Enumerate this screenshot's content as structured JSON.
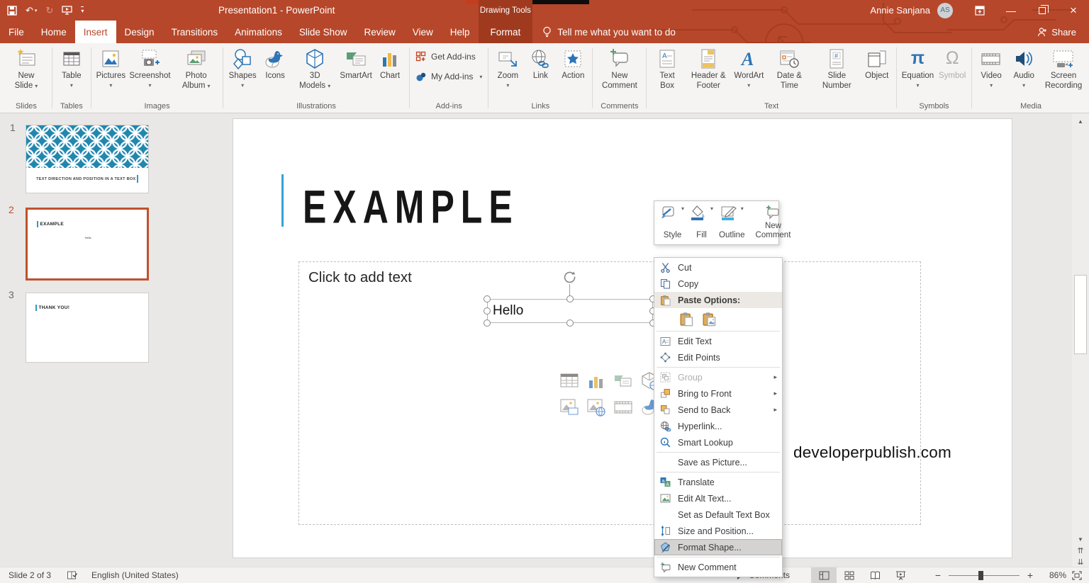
{
  "window": {
    "title": "Presentation1 - PowerPoint",
    "contextual_label": "Drawing Tools",
    "user_name": "Annie Sanjana",
    "user_initials": "AS"
  },
  "icons": {
    "dropdown": "▾",
    "submenu": "▸",
    "undo": "↶",
    "redo": "↻",
    "scroll_up": "▲",
    "scroll_down": "▼",
    "prev_slide": "⇈",
    "next_slide": "⇊",
    "minimize": "—",
    "close": "×",
    "collapse_ribbon": "∧",
    "pi": "π",
    "omega": "Ω"
  },
  "tabs": [
    {
      "label": "File"
    },
    {
      "label": "Home"
    },
    {
      "label": "Insert"
    },
    {
      "label": "Design"
    },
    {
      "label": "Transitions"
    },
    {
      "label": "Animations"
    },
    {
      "label": "Slide Show"
    },
    {
      "label": "Review"
    },
    {
      "label": "View"
    },
    {
      "label": "Help"
    },
    {
      "label": "Format"
    }
  ],
  "tellme": "Tell me what you want to do",
  "share_label": "Share",
  "ribbon": {
    "groups": [
      {
        "label": "Slides",
        "buttons": [
          {
            "label": "New Slide"
          }
        ]
      },
      {
        "label": "Tables",
        "buttons": [
          {
            "label": "Table"
          }
        ]
      },
      {
        "label": "Images",
        "buttons": [
          {
            "label": "Pictures"
          },
          {
            "label": "Screenshot"
          },
          {
            "label": "Photo Album"
          }
        ]
      },
      {
        "label": "Illustrations",
        "buttons": [
          {
            "label": "Shapes"
          },
          {
            "label": "Icons"
          },
          {
            "label": "3D Models"
          },
          {
            "label": "SmartArt"
          },
          {
            "label": "Chart"
          }
        ]
      },
      {
        "label": "Add-ins",
        "buttons": [
          {
            "label": "Get Add-ins"
          },
          {
            "label": "My Add-ins"
          }
        ]
      },
      {
        "label": "Links",
        "buttons": [
          {
            "label": "Zoom"
          },
          {
            "label": "Link"
          },
          {
            "label": "Action"
          }
        ]
      },
      {
        "label": "Comments",
        "buttons": [
          {
            "label": "New Comment"
          }
        ]
      },
      {
        "label": "Text",
        "buttons": [
          {
            "label": "Text Box"
          },
          {
            "label": "Header & Footer"
          },
          {
            "label": "WordArt"
          },
          {
            "label": "Date & Time"
          },
          {
            "label": "Slide Number"
          },
          {
            "label": "Object"
          }
        ]
      },
      {
        "label": "Symbols",
        "buttons": [
          {
            "label": "Equation"
          },
          {
            "label": "Symbol"
          }
        ]
      },
      {
        "label": "Media",
        "buttons": [
          {
            "label": "Video"
          },
          {
            "label": "Audio"
          },
          {
            "label": "Screen Recording"
          }
        ]
      }
    ]
  },
  "thumbnails": [
    {
      "number": "1",
      "caption": "TEXT DIRECTION AND POSITION IN A TEXT BOX"
    },
    {
      "number": "2",
      "title": "EXAMPLE",
      "body": "Hello"
    },
    {
      "number": "3",
      "title": "THANK YOU!"
    }
  ],
  "slide": {
    "title": "EXAMPLE",
    "content_placeholder": "Click to add text",
    "textbox_text": "Hello",
    "watermark": "developerpublish.com"
  },
  "mini_toolbar": {
    "style": "Style",
    "fill": "Fill",
    "outline": "Outline",
    "new_comment": "New Comment"
  },
  "context_menu": {
    "items": [
      {
        "label": "Cut"
      },
      {
        "label": "Copy"
      },
      {
        "label": "Paste Options:"
      },
      {
        "label": "Edit Text"
      },
      {
        "label": "Edit Points"
      },
      {
        "label": "Group"
      },
      {
        "label": "Bring to Front"
      },
      {
        "label": "Send to Back"
      },
      {
        "label": "Hyperlink..."
      },
      {
        "label": "Smart Lookup"
      },
      {
        "label": "Save as Picture..."
      },
      {
        "label": "Translate"
      },
      {
        "label": "Edit Alt Text..."
      },
      {
        "label": "Set as Default Text Box"
      },
      {
        "label": "Size and Position..."
      },
      {
        "label": "Format Shape..."
      },
      {
        "label": "New Comment"
      }
    ]
  },
  "status": {
    "slide_indicator": "Slide 2 of 3",
    "language": "English (United States)",
    "comments_label": "Comments",
    "zoom_level": "86%",
    "zoom_out": "−",
    "zoom_in": "+"
  }
}
